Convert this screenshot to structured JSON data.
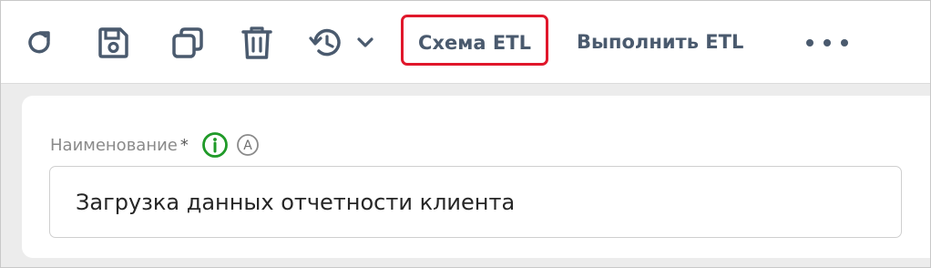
{
  "toolbar": {
    "icons": {
      "refresh": "refresh-icon",
      "save": "save-icon",
      "copy": "copy-icon",
      "delete": "trash-icon",
      "history": "history-icon"
    },
    "etl_schema_label": "Схема ETL",
    "run_etl_label": "Выполнить ETL",
    "more": "more-icon"
  },
  "form": {
    "name_label": "Наименование",
    "required_mark": "*",
    "name_value": "Загрузка данных отчетности клиента",
    "auto_badge": "A"
  },
  "colors": {
    "toolbar_icon": "#4a5a6e",
    "highlight": "#e0172b",
    "info_green": "#1f9a28"
  }
}
